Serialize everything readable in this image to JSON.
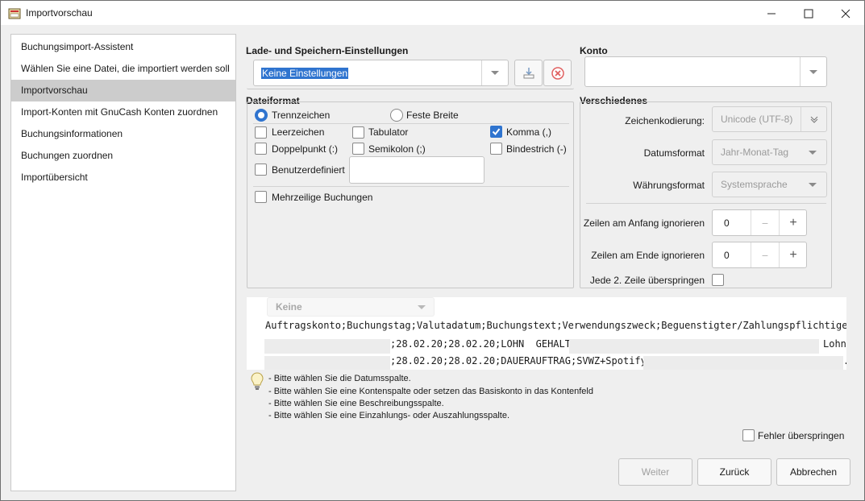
{
  "window": {
    "title": "Importvorschau"
  },
  "sidebar": {
    "items": [
      {
        "label": "Buchungsimport-Assistent"
      },
      {
        "label": "Wählen Sie eine Datei, die importiert werden soll"
      },
      {
        "label": "Importvorschau"
      },
      {
        "label": "Import-Konten mit GnuCash Konten zuordnen"
      },
      {
        "label": "Buchungsinformationen"
      },
      {
        "label": "Buchungen zuordnen"
      },
      {
        "label": "Importübersicht"
      }
    ]
  },
  "settings": {
    "heading": "Lade- und Speichern-Einstellungen",
    "selected": "Keine Einstellungen"
  },
  "account": {
    "heading": "Konto",
    "value": ""
  },
  "fileformat": {
    "heading": "Dateiformat",
    "radio_separator": "Trennzeichen",
    "radio_fixed": "Feste Breite",
    "space": "Leerzeichen",
    "tab": "Tabulator",
    "comma": "Komma (,)",
    "colon": "Doppelpunkt (:)",
    "semicolon": "Semikolon (;)",
    "hyphen": "Bindestrich (-)",
    "custom": "Benutzerdefiniert",
    "custom_value": "",
    "multiline": "Mehrzeilige Buchungen"
  },
  "misc": {
    "heading": "Verschiedenes",
    "encoding_label": "Zeichenkodierung:",
    "encoding_value": "Unicode (UTF-8)",
    "dateformat_label": "Datumsformat",
    "dateformat_value": "Jahr-Monat-Tag",
    "currency_label": "Währungsformat",
    "currency_value": "Systemsprache",
    "skip_start_label": "Zeilen am Anfang ignorieren",
    "skip_start_value": "0",
    "skip_end_label": "Zeilen am Ende ignorieren",
    "skip_end_value": "0",
    "skip_alt_label": "Jede 2. Zeile überspringen"
  },
  "preview": {
    "column_type": "Keine",
    "rows": [
      "Auftragskonto;Buchungstag;Valutadatum;Buchungstext;Verwendungszweck;Beguenstigter/Zahlungspflichtiger;K",
      ";28.02.20;28.02.20;LOHN  GEHALT;",
      "Lohn",
      ";28.02.20;28.02.20;DAUERAUFTRAG;SVWZ+Spotify;",
      "."
    ]
  },
  "hints": [
    "- Bitte wählen Sie die Datumsspalte.",
    "- Bitte wählen Sie eine Kontenspalte oder setzen das Basiskonto in das Kontenfeld",
    "- Bitte wählen Sie eine Beschreibungsspalte.",
    "- Bitte wählen Sie eine Einzahlungs- oder Auszahlungsspalte."
  ],
  "skip_errors": "Fehler überspringen",
  "buttons": {
    "next": "Weiter",
    "back": "Zurück",
    "cancel": "Abbrechen"
  },
  "colors": {
    "accent": "#2f74cf",
    "selection": "#2f74cf",
    "sidebar_active": "#cccccc"
  }
}
